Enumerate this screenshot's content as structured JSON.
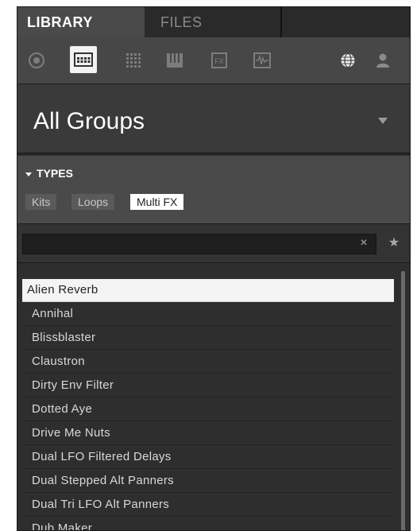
{
  "tabs": [
    {
      "label": "LIBRARY",
      "active": true
    },
    {
      "label": "FILES",
      "active": false
    }
  ],
  "icon_bar": {
    "left": [
      {
        "icon": "circle-icon",
        "selected": false
      },
      {
        "icon": "group-icon",
        "selected": true
      },
      {
        "icon": "sound-grid-icon",
        "selected": false
      },
      {
        "icon": "instrument-icon",
        "selected": false
      },
      {
        "icon": "fx-icon",
        "selected": false
      },
      {
        "icon": "sample-icon",
        "selected": false
      }
    ],
    "right": [
      {
        "icon": "globe-icon"
      },
      {
        "icon": "user-icon"
      }
    ]
  },
  "header": {
    "title": "All Groups"
  },
  "types": {
    "heading": "TYPES",
    "chips": [
      {
        "label": "Kits",
        "selected": false
      },
      {
        "label": "Loops",
        "selected": false
      },
      {
        "label": "Multi FX",
        "selected": true
      }
    ]
  },
  "search": {
    "value": "",
    "clear_glyph": "×",
    "star_glyph": "★"
  },
  "results": [
    {
      "label": "Alien Reverb",
      "selected": true
    },
    {
      "label": "Annihal",
      "selected": false
    },
    {
      "label": "Blissblaster",
      "selected": false
    },
    {
      "label": "Claustron",
      "selected": false
    },
    {
      "label": "Dirty Env Filter",
      "selected": false
    },
    {
      "label": "Dotted Aye",
      "selected": false
    },
    {
      "label": "Drive Me Nuts",
      "selected": false
    },
    {
      "label": "Dual LFO Filtered Delays",
      "selected": false
    },
    {
      "label": "Dual Stepped Alt Panners",
      "selected": false
    },
    {
      "label": "Dual Tri LFO Alt Panners",
      "selected": false
    },
    {
      "label": "Dub Maker",
      "selected": false
    }
  ],
  "colors": {
    "panel": "#2e2e2e",
    "selected_bg": "#f4f4f4",
    "text": "#d8d8d8"
  }
}
